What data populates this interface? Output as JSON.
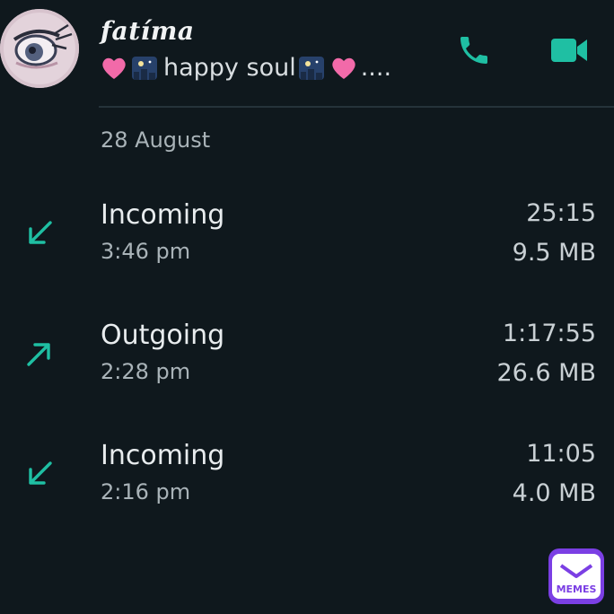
{
  "header": {
    "contact_name": "fatíma",
    "status_text": "happy soul",
    "status_suffix": "....",
    "call_icon": "phone-icon",
    "video_icon": "video-camera-icon"
  },
  "log": {
    "date": "28 August",
    "calls": [
      {
        "direction": "incoming",
        "type": "Incoming",
        "time": "3:46 pm",
        "duration": "25:15",
        "size": "9.5 MB"
      },
      {
        "direction": "outgoing",
        "type": "Outgoing",
        "time": "2:28 pm",
        "duration": "1:17:55",
        "size": "26.6 MB"
      },
      {
        "direction": "incoming",
        "type": "Incoming",
        "time": "2:16 pm",
        "duration": "11:05",
        "size": "4.0 MB"
      }
    ]
  },
  "watermark": {
    "text": "MEMES"
  },
  "colors": {
    "accent": "#1fbfa3",
    "background": "#0f181d"
  }
}
